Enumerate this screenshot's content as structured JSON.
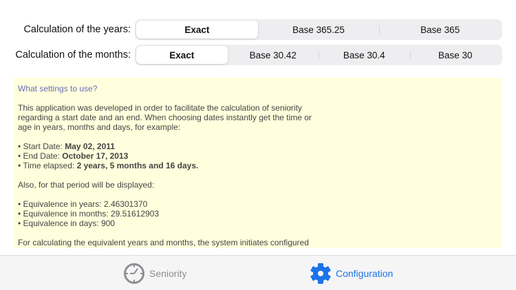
{
  "years": {
    "label": "Calculation of the years:",
    "options": [
      "Exact",
      "Base 365.25",
      "Base 365"
    ],
    "selected": "Exact"
  },
  "months": {
    "label": "Calculation of the months:",
    "options": [
      "Exact",
      "Base 30.42",
      "Base 30.4",
      "Base 30"
    ],
    "selected": "Exact"
  },
  "info": {
    "title": "What settings to use?",
    "intro": "This application was developed in order to facilitate the calculation of seniority regarding a start date and an end. When choosing dates instantly get the time or age in years, months and days, for example:",
    "start_label": "• Start Date: ",
    "start_value": "May 02, 2011",
    "end_label": "• End Date: ",
    "end_value": "October 17, 2013",
    "elapsed_label": "• Time elapsed: ",
    "elapsed_value": "2 years, 5 months and 16 days.",
    "also": "Also, for that period will be displayed:",
    "eq_years": "• Equivalence in years: 2.46301370",
    "eq_months": "• Equivalence in months: 29.51612903",
    "eq_days": "• Equivalence in days: 900",
    "more": "For calculating the equivalent years and months, the system initiates configured"
  },
  "tabs": [
    {
      "label": "Seniority",
      "icon": "clock-icon",
      "active": false
    },
    {
      "label": "Configuration",
      "icon": "gear-icon",
      "active": true
    }
  ],
  "colors": {
    "accent": "#1a73e8",
    "info_bg": "#ffffdd",
    "inactive": "#8e8e93"
  }
}
